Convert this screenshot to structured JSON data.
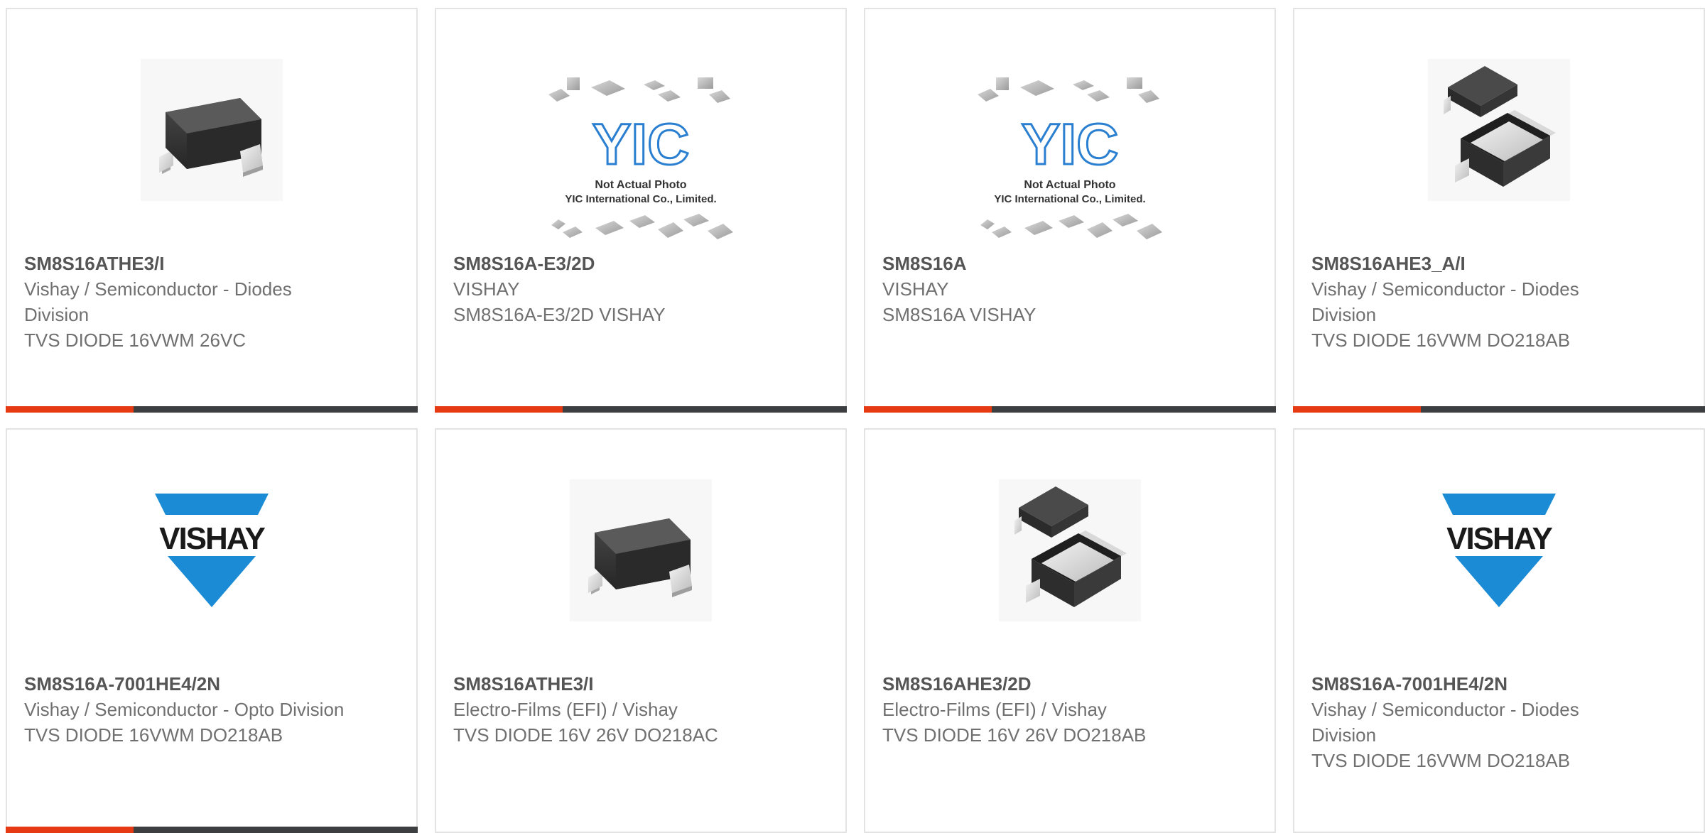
{
  "colors": {
    "accent": "#e53a14",
    "bar": "#3d3e40",
    "border": "#e3e3e3",
    "part_text": "#555555",
    "body_text": "#707070",
    "vishay_blue": "#1a8bd4",
    "yic_blue": "#2a7fd0"
  },
  "cards": [
    {
      "image": "smd-diode-package-image",
      "part_number": "SM8S16ATHE3/I",
      "manufacturer": "Vishay / Semiconductor - Diodes Division",
      "description": "TVS DIODE 16VWM 26VC",
      "accent_fraction": 0.31
    },
    {
      "image": "yic-not-actual-photo-image",
      "image_text": {
        "logo": "YIC",
        "line1": "Not Actual Photo",
        "line2": "YIC International Co., Limited."
      },
      "part_number": "SM8S16A-E3/2D",
      "manufacturer": "VISHAY",
      "description": "SM8S16A-E3/2D VISHAY",
      "accent_fraction": 0.31
    },
    {
      "image": "yic-not-actual-photo-image",
      "image_text": {
        "logo": "YIC",
        "line1": "Not Actual Photo",
        "line2": "YIC International Co., Limited."
      },
      "part_number": "SM8S16A",
      "manufacturer": "VISHAY",
      "description": "SM8S16A VISHAY",
      "accent_fraction": 0.31
    },
    {
      "image": "do218-package-image",
      "part_number": "SM8S16AHE3_A/I",
      "manufacturer": "Vishay / Semiconductor - Diodes Division",
      "description": "TVS DIODE 16VWM DO218AB",
      "accent_fraction": 0.31
    },
    {
      "image": "vishay-logo-image",
      "image_text": {
        "logo": "VISHAY"
      },
      "part_number": "SM8S16A-7001HE4/2N",
      "manufacturer": "Vishay / Semiconductor - Opto Division",
      "description": "TVS DIODE 16VWM DO218AB",
      "accent_fraction": 0.31
    },
    {
      "image": "smd-diode-package-image",
      "part_number": "SM8S16ATHE3/I",
      "manufacturer": "Electro-Films (EFI) / Vishay",
      "description": "TVS DIODE 16V 26V DO218AC",
      "accent_fraction": 0.31
    },
    {
      "image": "do218-package-image",
      "part_number": "SM8S16AHE3/2D",
      "manufacturer": "Electro-Films (EFI) / Vishay",
      "description": "TVS DIODE 16V 26V DO218AB",
      "accent_fraction": 0.31
    },
    {
      "image": "vishay-logo-image",
      "image_text": {
        "logo": "VISHAY"
      },
      "part_number": "SM8S16A-7001HE4/2N",
      "manufacturer": "Vishay / Semiconductor - Diodes Division",
      "description": "TVS DIODE 16VWM DO218AB",
      "accent_fraction": 0.31
    }
  ]
}
